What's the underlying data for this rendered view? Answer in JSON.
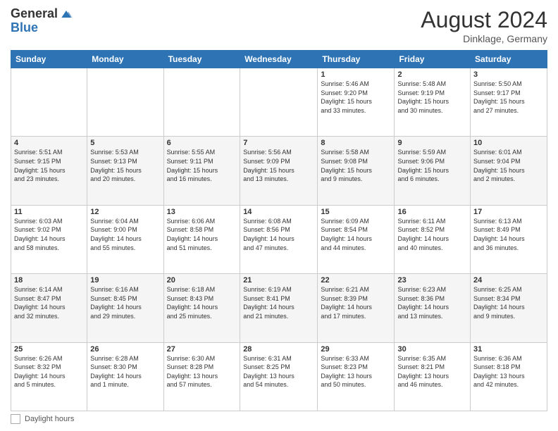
{
  "logo": {
    "general": "General",
    "blue": "Blue"
  },
  "header": {
    "month_year": "August 2024",
    "location": "Dinklage, Germany"
  },
  "days_of_week": [
    "Sunday",
    "Monday",
    "Tuesday",
    "Wednesday",
    "Thursday",
    "Friday",
    "Saturday"
  ],
  "footer": {
    "label": "Daylight hours"
  },
  "weeks": [
    [
      {
        "day": "",
        "info": ""
      },
      {
        "day": "",
        "info": ""
      },
      {
        "day": "",
        "info": ""
      },
      {
        "day": "",
        "info": ""
      },
      {
        "day": "1",
        "info": "Sunrise: 5:46 AM\nSunset: 9:20 PM\nDaylight: 15 hours\nand 33 minutes."
      },
      {
        "day": "2",
        "info": "Sunrise: 5:48 AM\nSunset: 9:19 PM\nDaylight: 15 hours\nand 30 minutes."
      },
      {
        "day": "3",
        "info": "Sunrise: 5:50 AM\nSunset: 9:17 PM\nDaylight: 15 hours\nand 27 minutes."
      }
    ],
    [
      {
        "day": "4",
        "info": "Sunrise: 5:51 AM\nSunset: 9:15 PM\nDaylight: 15 hours\nand 23 minutes."
      },
      {
        "day": "5",
        "info": "Sunrise: 5:53 AM\nSunset: 9:13 PM\nDaylight: 15 hours\nand 20 minutes."
      },
      {
        "day": "6",
        "info": "Sunrise: 5:55 AM\nSunset: 9:11 PM\nDaylight: 15 hours\nand 16 minutes."
      },
      {
        "day": "7",
        "info": "Sunrise: 5:56 AM\nSunset: 9:09 PM\nDaylight: 15 hours\nand 13 minutes."
      },
      {
        "day": "8",
        "info": "Sunrise: 5:58 AM\nSunset: 9:08 PM\nDaylight: 15 hours\nand 9 minutes."
      },
      {
        "day": "9",
        "info": "Sunrise: 5:59 AM\nSunset: 9:06 PM\nDaylight: 15 hours\nand 6 minutes."
      },
      {
        "day": "10",
        "info": "Sunrise: 6:01 AM\nSunset: 9:04 PM\nDaylight: 15 hours\nand 2 minutes."
      }
    ],
    [
      {
        "day": "11",
        "info": "Sunrise: 6:03 AM\nSunset: 9:02 PM\nDaylight: 14 hours\nand 58 minutes."
      },
      {
        "day": "12",
        "info": "Sunrise: 6:04 AM\nSunset: 9:00 PM\nDaylight: 14 hours\nand 55 minutes."
      },
      {
        "day": "13",
        "info": "Sunrise: 6:06 AM\nSunset: 8:58 PM\nDaylight: 14 hours\nand 51 minutes."
      },
      {
        "day": "14",
        "info": "Sunrise: 6:08 AM\nSunset: 8:56 PM\nDaylight: 14 hours\nand 47 minutes."
      },
      {
        "day": "15",
        "info": "Sunrise: 6:09 AM\nSunset: 8:54 PM\nDaylight: 14 hours\nand 44 minutes."
      },
      {
        "day": "16",
        "info": "Sunrise: 6:11 AM\nSunset: 8:52 PM\nDaylight: 14 hours\nand 40 minutes."
      },
      {
        "day": "17",
        "info": "Sunrise: 6:13 AM\nSunset: 8:49 PM\nDaylight: 14 hours\nand 36 minutes."
      }
    ],
    [
      {
        "day": "18",
        "info": "Sunrise: 6:14 AM\nSunset: 8:47 PM\nDaylight: 14 hours\nand 32 minutes."
      },
      {
        "day": "19",
        "info": "Sunrise: 6:16 AM\nSunset: 8:45 PM\nDaylight: 14 hours\nand 29 minutes."
      },
      {
        "day": "20",
        "info": "Sunrise: 6:18 AM\nSunset: 8:43 PM\nDaylight: 14 hours\nand 25 minutes."
      },
      {
        "day": "21",
        "info": "Sunrise: 6:19 AM\nSunset: 8:41 PM\nDaylight: 14 hours\nand 21 minutes."
      },
      {
        "day": "22",
        "info": "Sunrise: 6:21 AM\nSunset: 8:39 PM\nDaylight: 14 hours\nand 17 minutes."
      },
      {
        "day": "23",
        "info": "Sunrise: 6:23 AM\nSunset: 8:36 PM\nDaylight: 14 hours\nand 13 minutes."
      },
      {
        "day": "24",
        "info": "Sunrise: 6:25 AM\nSunset: 8:34 PM\nDaylight: 14 hours\nand 9 minutes."
      }
    ],
    [
      {
        "day": "25",
        "info": "Sunrise: 6:26 AM\nSunset: 8:32 PM\nDaylight: 14 hours\nand 5 minutes."
      },
      {
        "day": "26",
        "info": "Sunrise: 6:28 AM\nSunset: 8:30 PM\nDaylight: 14 hours\nand 1 minute."
      },
      {
        "day": "27",
        "info": "Sunrise: 6:30 AM\nSunset: 8:28 PM\nDaylight: 13 hours\nand 57 minutes."
      },
      {
        "day": "28",
        "info": "Sunrise: 6:31 AM\nSunset: 8:25 PM\nDaylight: 13 hours\nand 54 minutes."
      },
      {
        "day": "29",
        "info": "Sunrise: 6:33 AM\nSunset: 8:23 PM\nDaylight: 13 hours\nand 50 minutes."
      },
      {
        "day": "30",
        "info": "Sunrise: 6:35 AM\nSunset: 8:21 PM\nDaylight: 13 hours\nand 46 minutes."
      },
      {
        "day": "31",
        "info": "Sunrise: 6:36 AM\nSunset: 8:18 PM\nDaylight: 13 hours\nand 42 minutes."
      }
    ]
  ]
}
